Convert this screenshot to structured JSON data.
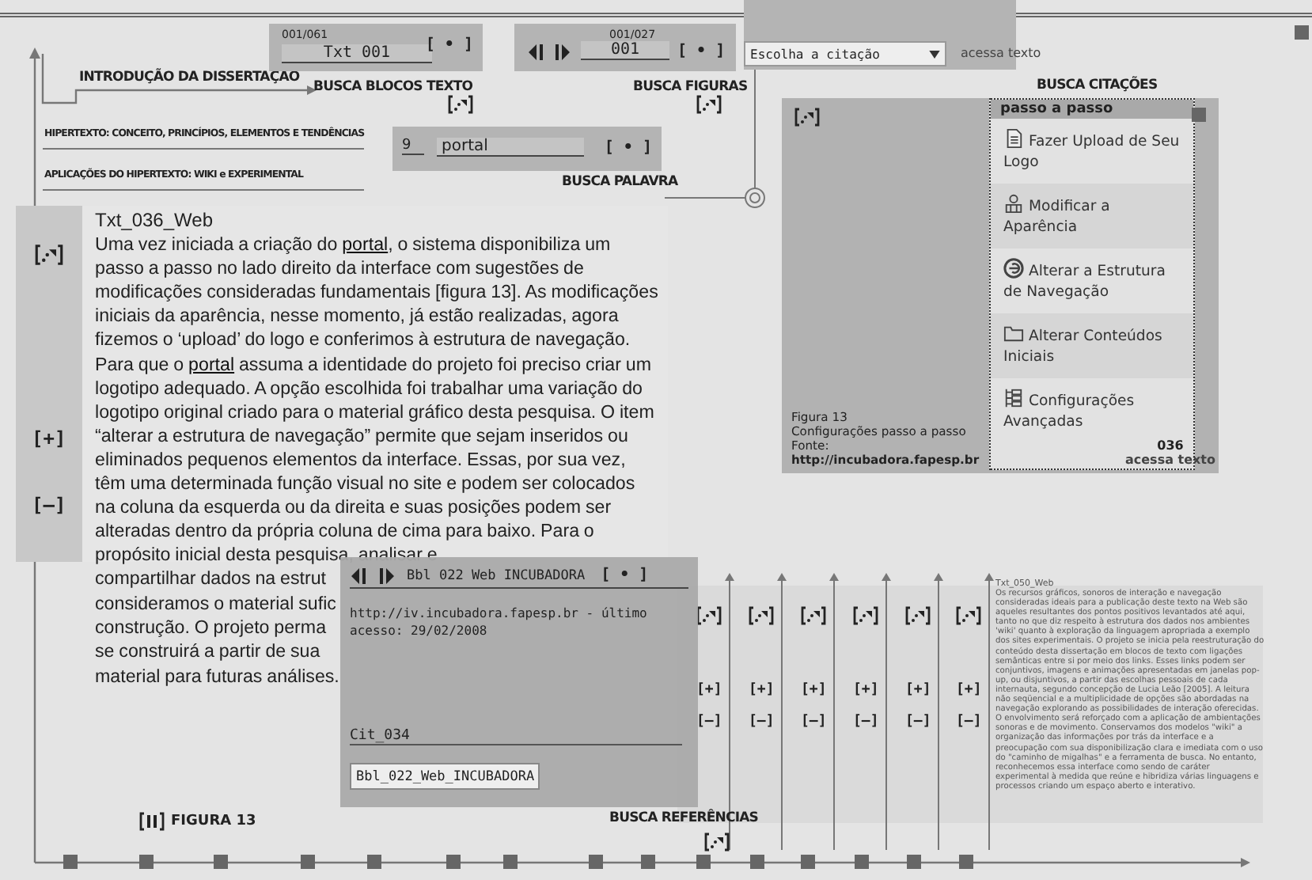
{
  "nav_links": [
    {
      "label": "INTRODUÇÃO DA DISSERTAÇÃO"
    },
    {
      "label": "HIPERTEXTO: CONCEITO, PRINCÍPIOS, ELEMENTOS E TENDÊNCIAS"
    },
    {
      "label": "APLICAÇÕES DO HIPERTEXTO: WIKI e EXPERIMENTAL"
    }
  ],
  "search_blocks": {
    "counter": "001/061",
    "value": "Txt 001",
    "go": "[ • ]",
    "label": "BUSCA BLOCOS TEXTO"
  },
  "search_figures": {
    "counter": "001/027",
    "value": "001",
    "go": "[ • ]",
    "label": "BUSCA FIGURAS"
  },
  "search_word": {
    "count": "9",
    "value": "portal",
    "go": "[ • ]",
    "label": "BUSCA PALAVRA"
  },
  "search_citations": {
    "select": "Escolha a citação",
    "link": "acessa texto",
    "label": "BUSCA CITAÇÕES"
  },
  "text_window": {
    "title": "Txt_036_Web",
    "segments": [
      {
        "text": "Uma vez iniciada a criação do ",
        "link": false
      },
      {
        "text": "portal",
        "link": true
      },
      {
        "text": ", o sistema disponibiliza um passo a passo no lado direito da interface com sugestões de modificações consideradas fundamentais [figura 13]. As modificações iniciais da aparência, nesse momento, já estão realizadas, agora fizemos o ‘upload’ do logo e conferimos à estrutura de navegação. Para que o ",
        "link": false
      },
      {
        "text": "portal",
        "link": true
      },
      {
        "text": " assuma a identidade do projeto foi preciso criar um logotipo adequado. A opção escolhida foi trabalhar uma variação do logotipo original criado para o material gráfico desta pesquisa. O item “alterar a estrutura de navegação” permite que sejam inseridos ou eliminados pequenos elementos da interface. Essas, por sua vez, têm uma determinada função visual no site e podem ser colocados na coluna da esquerda ou da direita e suas posições podem ser alteradas dentro da própria coluna de cima para baixo. Para o propósito inicial desta pesquisa, analisar e",
        "link": false
      }
    ],
    "covered_lines": [
      "compartilhar dados na estrut",
      "consideramos o material sufic",
      "construção. O projeto perma",
      "se construirá a partir de sua",
      "material para futuras análises."
    ],
    "buttons": [
      "[+]",
      "[—]"
    ]
  },
  "figure_window": {
    "caption": [
      "Figura 13",
      "Configurações passo a passo",
      "Fonte:"
    ],
    "source": "http://incubadora.fapesp.br",
    "panel_title": "passo a passo",
    "steps": [
      {
        "kind": "document",
        "label": "Fazer Upload de Seu Logo"
      },
      {
        "kind": "appearance",
        "label": "Modificar a Aparência"
      },
      {
        "kind": "navigation",
        "label": "Alterar a Estrutura de Navegação"
      },
      {
        "kind": "folder",
        "label": "Alterar Conteúdos Iniciais"
      },
      {
        "kind": "settings",
        "label": "Configurações Avançadas"
      }
    ],
    "number": "036",
    "link": "acessa texto"
  },
  "reference_window": {
    "title": "Bbl 022 Web INCUBADORA",
    "go": "[ • ]",
    "text": "http://iv.incubadora.fapesp.br - último acesso: 29/02/2008",
    "citation": "Cit_034",
    "select": "Bbl_022_Web_INCUBADORA"
  },
  "figure_link": "FIGURA 13",
  "references_label": "BUSCA REFERÊNCIAS",
  "text_columns": [
    {
      "buttons": [
        "[+]",
        "[—]"
      ]
    },
    {
      "buttons": [
        "[+]",
        "[—]"
      ]
    },
    {
      "buttons": [
        "[+]",
        "[—]"
      ]
    },
    {
      "buttons": [
        "[+]",
        "[—]"
      ]
    },
    {
      "buttons": [
        "[+]",
        "[—]"
      ]
    },
    {
      "buttons": [
        "[+]",
        "[—]"
      ]
    }
  ],
  "last_block": {
    "title": "Txt_050_Web",
    "text": "Os recursos gráficos, sonoros de interação e navegação consideradas ideais para a publicação deste texto na Web são aqueles resultantes dos pontos positivos levantados até aqui, tanto no que diz respeito à estrutura dos dados nos ambientes 'wiki' quanto à exploração da linguagem apropriada a exemplo dos sites experimentais. O projeto se inicia pela reestruturação do conteúdo desta dissertação em blocos de texto com ligações semânticas entre si por meio dos links. Esses links podem ser conjuntivos, imagens e animações apresentadas em janelas pop-up, ou disjuntivos, a partir das escolhas pessoais de cada internauta, segundo concepção de Lucia Leão [2005]. A leitura não seqüencial e a multiplicidade de opções são abordadas na navegação explorando as possibilidades de interação oferecidas. O envolvimento será reforçado com a aplicação de ambientações sonoras e de movimento. Conservamos dos modelos \"wiki\" a organização das informações por trás da interface e a preocupação com sua disponibilização clara e imediata com o uso do \"caminho de migalhas\" e a ferramenta de busca. No entanto, reconhecemos essa interface como sendo de caráter experimental à medida que reúne e hibridiza várias linguagens e processos criando um espaço aberto e interativo."
  }
}
